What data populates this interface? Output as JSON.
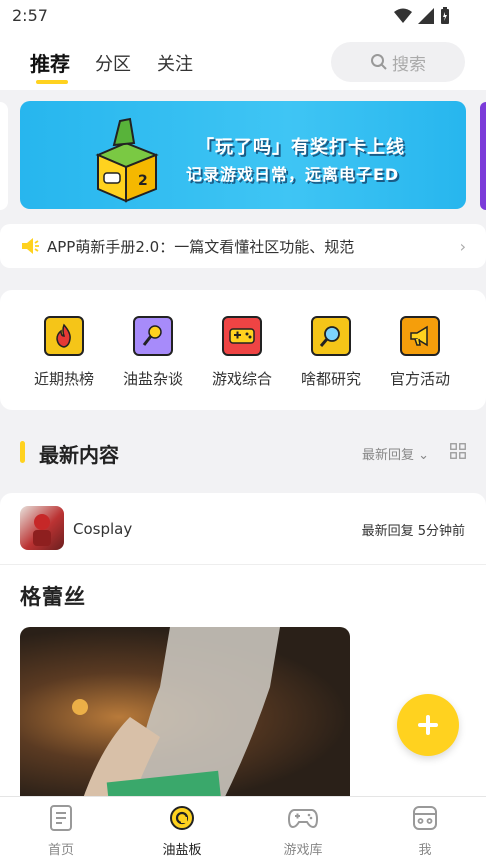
{
  "status_bar": {
    "time": "2:57"
  },
  "top_tabs": [
    {
      "label": "推荐",
      "active": true
    },
    {
      "label": "分区",
      "active": false
    },
    {
      "label": "关注",
      "active": false
    }
  ],
  "search": {
    "placeholder": "搜索",
    "icon": "search-icon"
  },
  "banner": {
    "line1": "「玩了吗」有奖打卡上线",
    "line2": "记录游戏日常，远离电子ED"
  },
  "notice": {
    "text": "APP萌新手册2.0：一篇文看懂社区功能、规范",
    "icon": "speaker-icon"
  },
  "categories": [
    {
      "label": "近期热榜",
      "icon": "fire-icon",
      "color": "#f5c518"
    },
    {
      "label": "油盐杂谈",
      "icon": "microphone-icon",
      "color": "#a78bfa"
    },
    {
      "label": "游戏综合",
      "icon": "gamepad-icon",
      "color": "#ef4444"
    },
    {
      "label": "啥都研究",
      "icon": "magnifier-icon",
      "color": "#f5c518"
    },
    {
      "label": "官方活动",
      "icon": "megaphone-icon",
      "color": "#f59e0b"
    }
  ],
  "section": {
    "title": "最新内容",
    "sort_label": "最新回复"
  },
  "post": {
    "board": "Cosplay",
    "meta": "最新回复 5分钟前",
    "title": "格蕾丝"
  },
  "bottom_nav": [
    {
      "label": "首页",
      "icon": "document-icon",
      "active": false
    },
    {
      "label": "油盐板",
      "icon": "board-icon",
      "active": true
    },
    {
      "label": "游戏库",
      "icon": "gamepad-icon",
      "active": false
    },
    {
      "label": "我",
      "icon": "profile-icon",
      "active": false
    }
  ],
  "colors": {
    "accent": "#ffd21f",
    "banner": "#27b6ee"
  }
}
